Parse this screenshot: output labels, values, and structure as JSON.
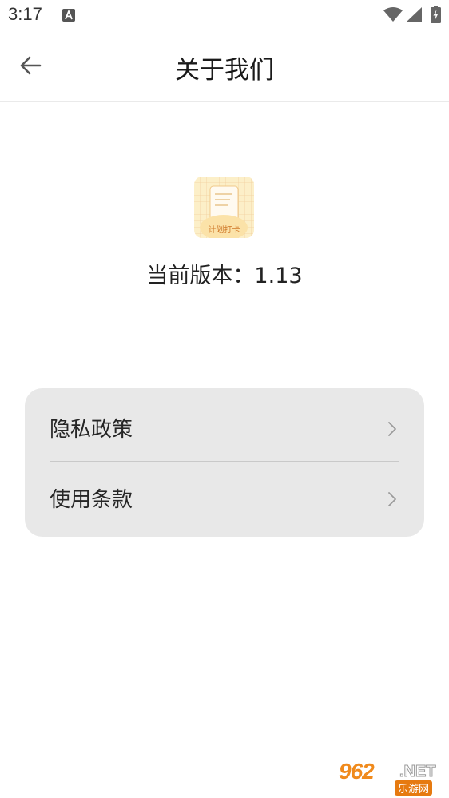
{
  "status_bar": {
    "time": "3:17",
    "notification_icon": "a-icon",
    "wifi_icon": "wifi-icon",
    "signal_icon": "signal-icon",
    "battery_icon": "battery-charging-icon"
  },
  "header": {
    "back_icon": "arrow-left-icon",
    "title": "关于我们"
  },
  "app_info": {
    "icon_text": "计划打卡",
    "version_label": "当前版本：1.13"
  },
  "menu": {
    "items": [
      {
        "label": "隐私政策",
        "icon": "chevron-right-icon"
      },
      {
        "label": "使用条款",
        "icon": "chevron-right-icon"
      }
    ]
  },
  "watermark": {
    "brand": "962",
    "suffix": ".NET",
    "subtitle": "乐游网"
  },
  "colors": {
    "card_background": "#e8e8e8",
    "app_icon_background": "#fcefc8",
    "watermark_orange": "#f08a1c"
  }
}
